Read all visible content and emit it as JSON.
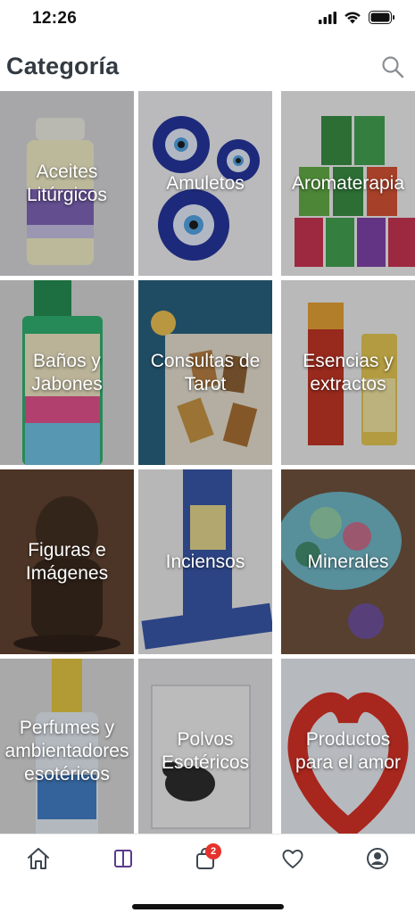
{
  "status": {
    "time": "12:26"
  },
  "header": {
    "title": "Categoría"
  },
  "categories": [
    {
      "label": "Aceites\nLitúrgicos"
    },
    {
      "label": "Amuletos"
    },
    {
      "label": "Aromaterapia"
    },
    {
      "label": "Baños y\nJabones"
    },
    {
      "label": "Consultas de\nTarot"
    },
    {
      "label": "Esencias y\nextractos"
    },
    {
      "label": "Figuras e\nImágenes"
    },
    {
      "label": "Inciensos"
    },
    {
      "label": "Minerales"
    },
    {
      "label": "Perfumes y\nambientadores\nesotéricos"
    },
    {
      "label": "Polvos\nEsotéricos"
    },
    {
      "label": "Productos\npara el amor"
    }
  ],
  "tabbar": {
    "cart_badge": "2",
    "tabs": [
      "home-icon",
      "catalog-icon",
      "cart-icon",
      "heart-icon",
      "account-icon"
    ]
  },
  "colors": {
    "accent": "#5b3a8c",
    "badge": "#e5322d",
    "icon": "#3d4650"
  }
}
